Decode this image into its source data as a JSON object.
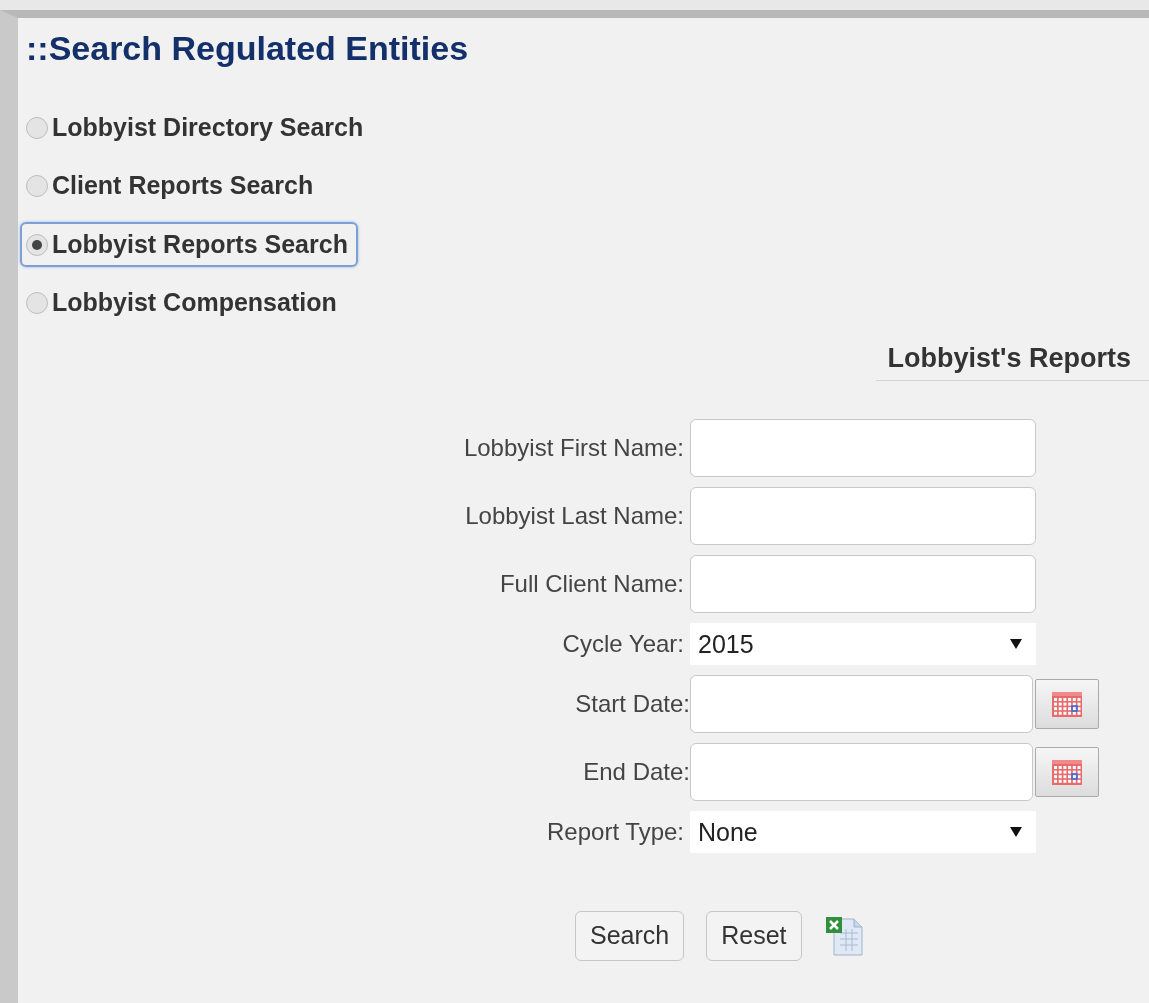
{
  "title": "::Search Regulated Entities",
  "search_options": [
    {
      "label": "Lobbyist Directory Search",
      "selected": false
    },
    {
      "label": "Client Reports Search",
      "selected": false
    },
    {
      "label": "Lobbyist Reports Search",
      "selected": true
    },
    {
      "label": "Lobbyist Compensation",
      "selected": false
    }
  ],
  "section": {
    "title": "Lobbyist's Reports"
  },
  "fields": [
    {
      "kind": "text",
      "label": "Lobbyist First Name:"
    },
    {
      "kind": "text",
      "label": "Lobbyist Last Name:"
    },
    {
      "kind": "text",
      "label": "Full Client Name:"
    },
    {
      "kind": "select",
      "label": "Cycle Year:",
      "value": "2015"
    },
    {
      "kind": "date",
      "label": "Start Date:"
    },
    {
      "kind": "date",
      "label": "End Date:"
    },
    {
      "kind": "select",
      "label": "Report Type:",
      "value": "None"
    }
  ],
  "buttons": [
    "Search",
    "Reset"
  ]
}
